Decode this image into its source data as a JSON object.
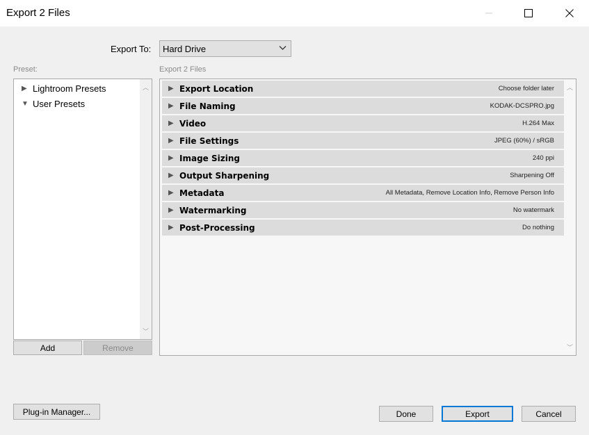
{
  "window": {
    "title": "Export 2 Files",
    "controls": [
      "minimize-icon",
      "maximize-icon",
      "close-icon"
    ]
  },
  "export_to": {
    "label": "Export To:",
    "selected": "Hard Drive"
  },
  "preset": {
    "section_label": "Preset:",
    "items": [
      {
        "label": "Lightroom Presets",
        "expanded": false
      },
      {
        "label": "User Presets",
        "expanded": true
      }
    ],
    "add_label": "Add",
    "remove_label": "Remove"
  },
  "settings": {
    "section_label": "Export 2 Files",
    "rows": [
      {
        "name": "Export Location",
        "value": "Choose folder later"
      },
      {
        "name": "File Naming",
        "value": "KODAK-DCSPRO.jpg"
      },
      {
        "name": "Video",
        "value": "H.264 Max"
      },
      {
        "name": "File Settings",
        "value": "JPEG (60%) / sRGB"
      },
      {
        "name": "Image Sizing",
        "value": "240 ppi"
      },
      {
        "name": "Output Sharpening",
        "value": "Sharpening Off"
      },
      {
        "name": "Metadata",
        "value": "All Metadata, Remove Location Info, Remove Person Info"
      },
      {
        "name": "Watermarking",
        "value": "No watermark"
      },
      {
        "name": "Post-Processing",
        "value": "Do nothing"
      }
    ]
  },
  "footer": {
    "plugin_manager_label": "Plug-in Manager...",
    "done_label": "Done",
    "export_label": "Export",
    "cancel_label": "Cancel"
  }
}
